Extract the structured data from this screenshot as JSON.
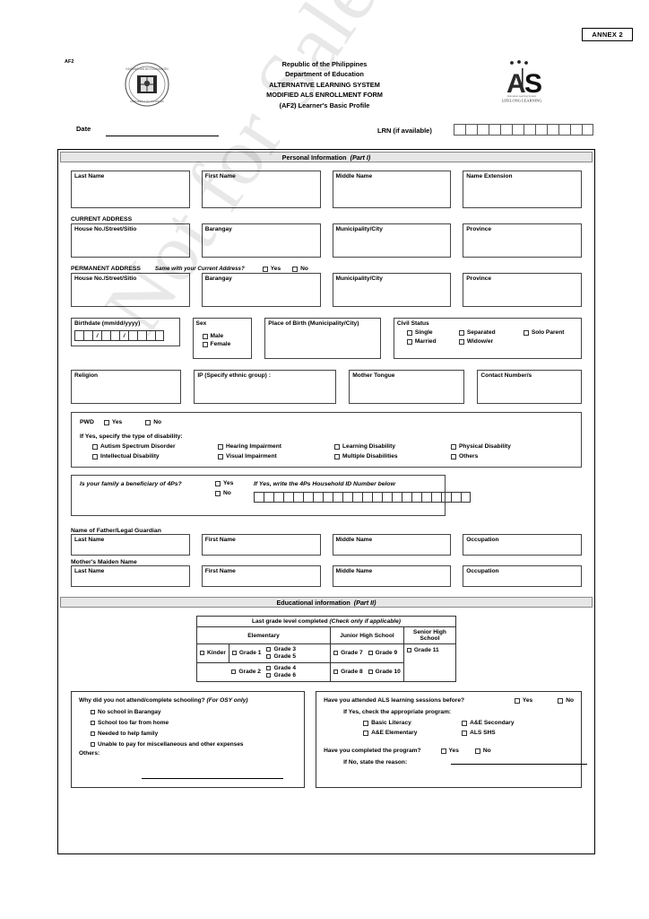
{
  "header": {
    "annex": "ANNEX 2",
    "form_code": "AF2",
    "line1": "Republic of the Philippines",
    "line2": "Department of Education",
    "line3": "ALTERNATIVE LEARNING SYSTEM",
    "line4": "MODIFIED ALS ENROLLMENT FORM",
    "line5": "(AF2) Learner's Basic Profile",
    "date_label": "Date",
    "lrn_label": "LRN (if available)",
    "lrn_boxes": 12,
    "deped_logo": "deped-seal-logo",
    "als_logo": "als-lifelong-learning-logo",
    "als_logo_tagline": "LIFELONG LEARNING"
  },
  "part1": {
    "band_title": "Personal Information",
    "band_part": "(Part I)",
    "name_fields": [
      "Last Name",
      "First Name",
      "Middle Name",
      "Name Extension"
    ],
    "current_address_label": "CURRENT ADDRESS",
    "address_fields": [
      "House No./Street/Sitio",
      "Barangay",
      "Municipality/City",
      "Province"
    ],
    "permanent_address_label": "PERMANENT ADDRESS",
    "permanent_question": "Same with your Current Address?",
    "yes": "Yes",
    "no": "No",
    "birthdate_label": "Birthdate (mm/dd/yyyy)",
    "birthdate_separator": "/",
    "sex_label": "Sex",
    "sex_options": [
      "Male",
      "Female"
    ],
    "place_of_birth_label": "Place of Birth (Municipality/City)",
    "civil_status_label": "Civil Status",
    "civil_status_options": [
      "Single",
      "Separated",
      "Solo Parent",
      "Married",
      "Widow/er"
    ],
    "religion_label": "Religion",
    "ip_label": "IP (Specify ethnic group) :",
    "mother_tongue_label": "Mother Tongue",
    "contact_label": "Contact Number/s",
    "pwd_label": "PWD",
    "pwd_specify": "If Yes, specify the type of disability:",
    "disabilities": [
      "Autism Spectrum Disorder",
      "Hearing Impairment",
      "Learning Disability",
      "Physical Disability",
      "Intellectual Disability",
      "Visual Impairment",
      "Multiple Disabilities",
      "Others"
    ],
    "fourps_question": "Is your family a beneficiary of 4Ps?",
    "fourps_hint": "If Yes, write the 4Ps Household ID Number below",
    "fourps_boxes": 22,
    "father_label": "Name of Father/Legal Guardian",
    "mother_label": "Mother's Maiden Name",
    "parent_fields": [
      "Last Name",
      "First Name",
      "Middle Name",
      "Occupation"
    ]
  },
  "part2": {
    "band_title": "Educational information",
    "band_part": "(Part II)",
    "grade_table_title": "Last grade level completed",
    "grade_table_title_italic": "(Check only if applicable)",
    "levels": [
      "Elementary",
      "Junior High School",
      "Senior High School"
    ],
    "elementary_col1": [
      "Kinder"
    ],
    "elementary_grid": [
      [
        "Grade 1",
        "Grade 3",
        "Grade 5"
      ],
      [
        "Grade 2",
        "Grade 4",
        "Grade 6"
      ]
    ],
    "jhs_grid": [
      [
        "Grade 7",
        "Grade 9"
      ],
      [
        "Grade 8",
        "Grade 10"
      ]
    ],
    "shs_grid": [
      [
        "Grade 11"
      ]
    ],
    "osy_question": "Why did you not attend/complete schooling?",
    "osy_question_italic": "(For OSY only)",
    "osy_reasons": [
      "No school in Barangay",
      "School too far from home",
      "Needed to help family",
      "Unable to pay for miscellaneous and other expenses"
    ],
    "osy_others": "Others:",
    "als_question1": "Have you attended ALS learning sessions before?",
    "als_subquestion": "If Yes, check the appropriate program:",
    "als_programs": [
      "Basic  Literacy",
      "A&E Secondary",
      "A&E Elementary",
      "ALS SHS"
    ],
    "als_question2": "Have you completed the program?",
    "als_question3": "If No, state the reason:",
    "yes": "Yes",
    "no": "No"
  },
  "watermark": {
    "text": "Not for Sale"
  },
  "colors": {
    "band_bg": "#e6e6e6",
    "border": "#000000",
    "text": "#000000"
  }
}
